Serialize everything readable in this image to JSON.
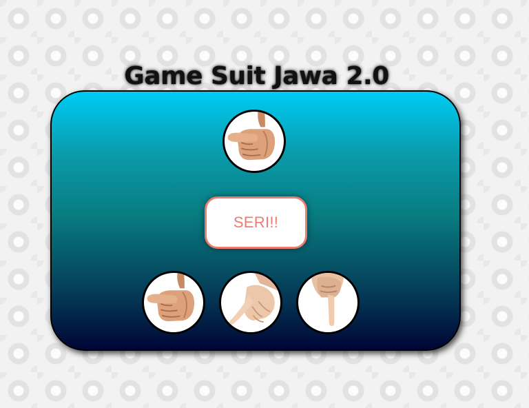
{
  "title": "Game Suit Jawa 2.0",
  "result": "SERI!!",
  "computer_choice": {
    "icon": "thumb-hand-icon"
  },
  "player_choices": [
    {
      "icon": "thumb-hand-icon"
    },
    {
      "icon": "index-finger-hand-icon"
    },
    {
      "icon": "pinky-finger-hand-icon"
    }
  ],
  "colors": {
    "board_gradient_top": "#00ccf5",
    "board_gradient_bottom": "#000535",
    "result_accent": "#ec7c6f",
    "title": "#111111"
  }
}
